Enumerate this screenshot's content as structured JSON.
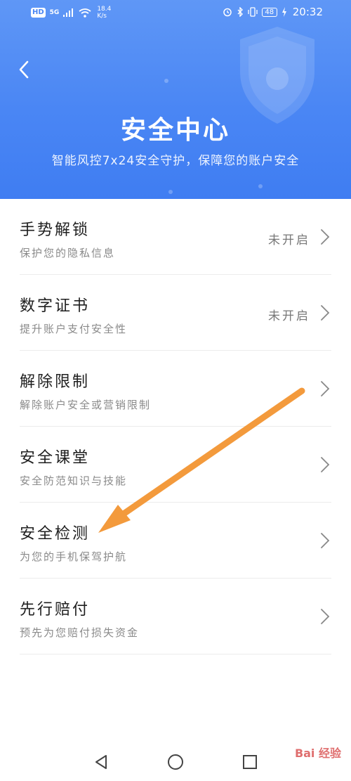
{
  "status_bar": {
    "hd": "HD",
    "network": "5G",
    "speed_value": "18.4",
    "speed_unit": "K/s",
    "battery": "48",
    "time": "20:32"
  },
  "header": {
    "title": "安全中心",
    "subtitle": "智能风控7x24安全守护，保障您的账户安全",
    "background_color": "#4a86f4"
  },
  "items": [
    {
      "title": "手势解锁",
      "desc": "保护您的隐私信息",
      "status": "未开启"
    },
    {
      "title": "数字证书",
      "desc": "提升账户支付安全性",
      "status": "未开启"
    },
    {
      "title": "解除限制",
      "desc": "解除账户安全或营销限制",
      "status": ""
    },
    {
      "title": "安全课堂",
      "desc": "安全防范知识与技能",
      "status": ""
    },
    {
      "title": "安全检测",
      "desc": "为您的手机保驾护航",
      "status": ""
    },
    {
      "title": "先行赔付",
      "desc": "预先为您赔付损失资金",
      "status": ""
    }
  ],
  "annotation_arrow_color": "#f39a3c",
  "watermark": "Bai 经验",
  "icons": {
    "back": "chevron-left-icon",
    "row": "chevron-right-icon",
    "nav_back": "triangle-back-icon",
    "nav_home": "circle-home-icon",
    "nav_recent": "square-recent-icon"
  }
}
